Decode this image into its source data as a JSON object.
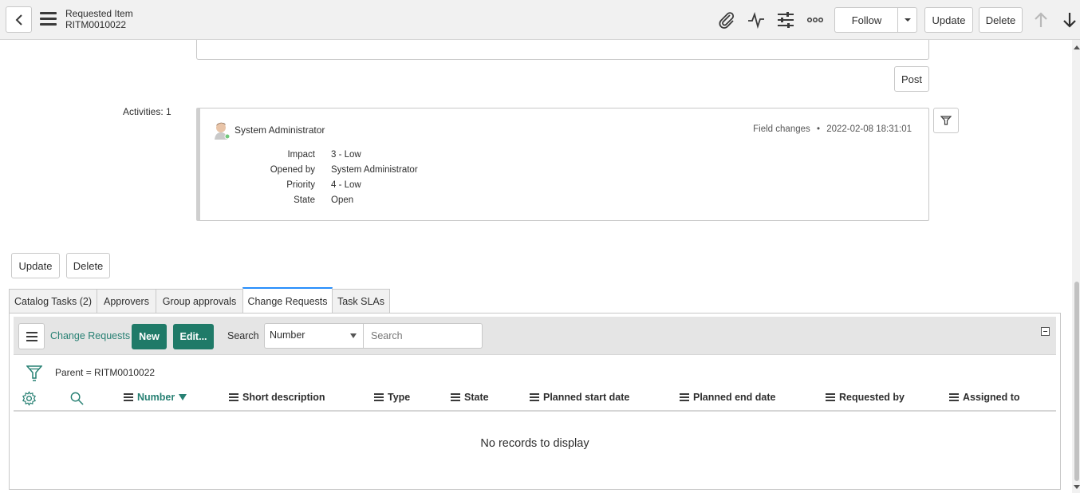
{
  "header": {
    "title": "Requested Item",
    "record_number": "RITM0010022",
    "follow_label": "Follow",
    "update_label": "Update",
    "delete_label": "Delete",
    "icons": [
      "paperclip-icon",
      "activity-icon",
      "settings-sliders-icon",
      "more-options-icon",
      "arrow-up-icon",
      "arrow-down-icon"
    ]
  },
  "activity": {
    "post_label": "Post",
    "activities_label": "Activities: 1",
    "entry": {
      "author": "System Administrator",
      "type": "Field changes",
      "separator": "•",
      "timestamp": "2022-02-08 18:31:01",
      "fields": [
        {
          "label": "Impact",
          "value": "3 - Low"
        },
        {
          "label": "Opened by",
          "value": "System Administrator"
        },
        {
          "label": "Priority",
          "value": "4 - Low"
        },
        {
          "label": "State",
          "value": "Open"
        }
      ]
    }
  },
  "form_actions": {
    "update_label": "Update",
    "delete_label": "Delete"
  },
  "tabs": [
    {
      "label": "Catalog Tasks (2)",
      "active": false
    },
    {
      "label": "Approvers",
      "active": false
    },
    {
      "label": "Group approvals",
      "active": false
    },
    {
      "label": "Change Requests",
      "active": true
    },
    {
      "label": "Task SLAs",
      "active": false
    }
  ],
  "related_list": {
    "title": "Change Requests",
    "new_label": "New",
    "edit_label": "Edit...",
    "search_label": "Search",
    "search_field": "Number",
    "search_placeholder": "Search",
    "breadcrumb": "Parent = RITM0010022",
    "columns": [
      "Number",
      "Short description",
      "Type",
      "State",
      "Planned start date",
      "Planned end date",
      "Requested by",
      "Assigned to"
    ],
    "sorted_column": "Number",
    "empty_message": "No records to display"
  },
  "colors": {
    "accent_green": "#1f7a68",
    "link_green": "#278073",
    "active_tab_border": "#278efc",
    "presence_online": "#71c77c"
  }
}
